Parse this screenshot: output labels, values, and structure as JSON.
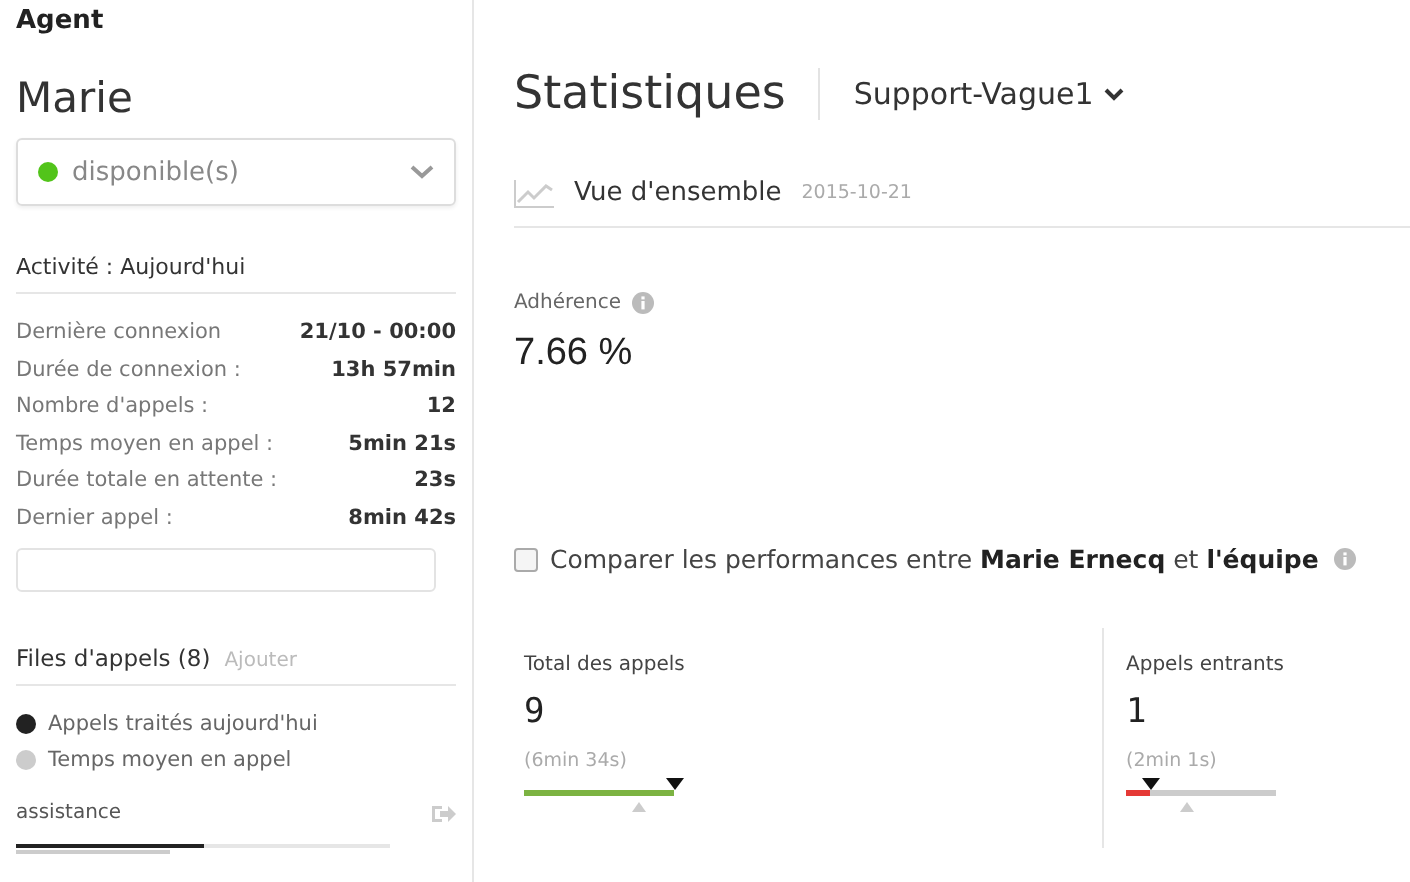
{
  "header": {
    "title": "Agent"
  },
  "agent": {
    "name": "Marie",
    "status": {
      "label": "disponible(s)",
      "color": "#52c41a"
    }
  },
  "activity": {
    "title": "Activité : Aujourd'hui",
    "rows": [
      {
        "label": "Dernière connexion",
        "value": "21/10 - 00:00"
      },
      {
        "label": "Durée de connexion :",
        "value": "13h 57min"
      },
      {
        "label": "Nombre d'appels :",
        "value": "12"
      },
      {
        "label": "Temps moyen en appel :",
        "value": "5min 21s"
      },
      {
        "label": "Durée totale en attente :",
        "value": "23s"
      },
      {
        "label": "Dernier appel :",
        "value": "8min 42s"
      }
    ]
  },
  "queues": {
    "title": "Files d'appels (8)",
    "add_link": "Ajouter",
    "legend": [
      {
        "label": "Appels traités aujourd'hui",
        "color": "#222222"
      },
      {
        "label": "Temps moyen en appel",
        "color": "#cccccc"
      }
    ],
    "items": [
      {
        "name": "assistance",
        "bars": [
          {
            "level": 0.5,
            "color": "#222222"
          },
          {
            "level": 0.41,
            "color": "#cccccc"
          }
        ]
      }
    ]
  },
  "stats": {
    "title": "Statistiques",
    "group": "Support-Vague1",
    "overview": {
      "title": "Vue d'ensemble",
      "date": "2015-10-21"
    },
    "adherence": {
      "label": "Adhérence",
      "value": "7.66 %"
    },
    "compare": {
      "checked": false,
      "text": "Comparer les performances entre **Marie Ernecq** et **l'équipe**"
    },
    "cards": [
      {
        "title": "Total des appels",
        "value": "9",
        "duration": "(6min 34s)",
        "level": 1,
        "color": "#7cb342",
        "average": {
          "level": 0.76
        }
      },
      {
        "title": "Appels entrants",
        "value": "1",
        "duration": "(2min 1s)",
        "level": 0.16,
        "color": "#e53935",
        "average": {
          "level": 0.4
        }
      }
    ]
  }
}
